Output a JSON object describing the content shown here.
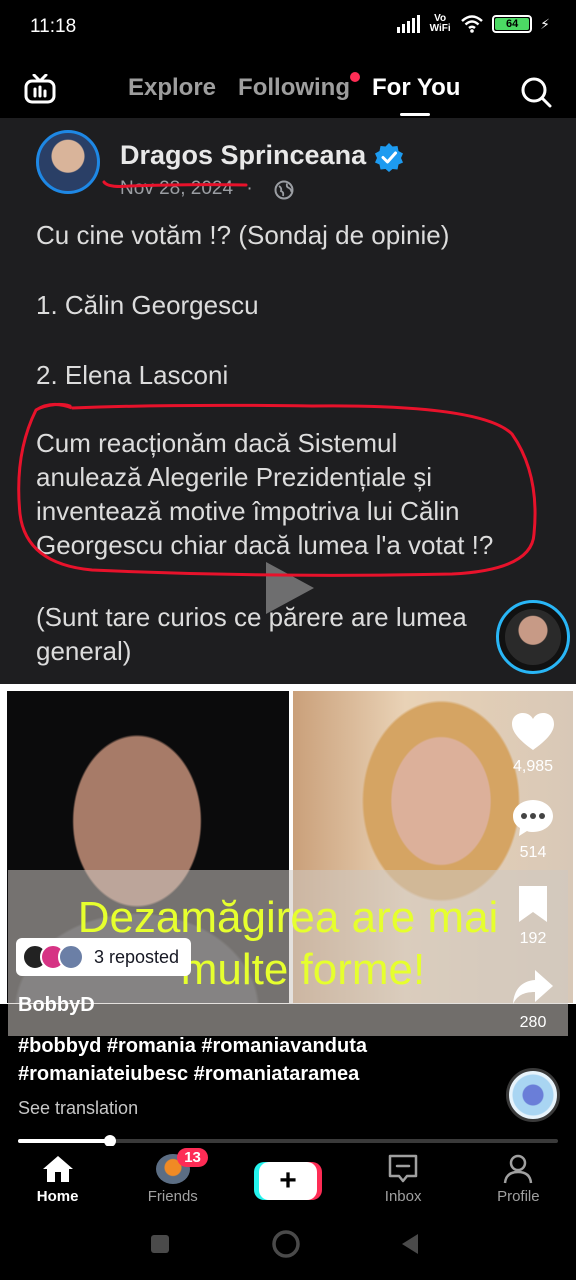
{
  "status_bar": {
    "time": "11:18",
    "network": "Vo WiFi",
    "battery": "64"
  },
  "top_nav": {
    "tabs": [
      {
        "label": "Explore",
        "active": false
      },
      {
        "label": "Following",
        "active": false,
        "has_dot": true
      },
      {
        "label": "For You",
        "active": true
      }
    ]
  },
  "post": {
    "author": "Dragos Sprinceana",
    "date": "Nov 28, 2024",
    "separator": "·",
    "lines": [
      "Cu cine votăm !? (Sondaj de opinie)",
      "1. Călin Georgescu",
      "2. Elena Lasconi",
      "Cum reacționăm dacă Sistemul",
      "anulează Alegerile Prezidențiale și",
      "inventează motive împotriva lui Călin",
      "Georgescu chiar dacă lumea l'a votat !?",
      "(Sunt tare curios ce părere are lumea",
      "general)"
    ]
  },
  "overlay": {
    "line1": "Dezamăgirea are mai",
    "line2": "multe forme!"
  },
  "actions": {
    "likes": "4,985",
    "comments": "514",
    "saves": "192",
    "shares": "280"
  },
  "repost": {
    "label": "3 reposted"
  },
  "video": {
    "username": "BobbyD",
    "caption_line1": "#bobbyd #romania #romaniavanduta",
    "caption_line2": "#romaniateiubesc #romaniataramea",
    "see_translation": "See translation",
    "progress": 0.17
  },
  "bottom_nav": {
    "items": [
      {
        "label": "Home",
        "active": true
      },
      {
        "label": "Friends",
        "badge": "13"
      },
      {
        "label": ""
      },
      {
        "label": "Inbox"
      },
      {
        "label": "Profile"
      }
    ]
  },
  "colors": {
    "accent": "#fe2c55",
    "overlay_text": "#e6ff2e",
    "verified": "#1d9bf0",
    "annotation_red": "#e8122b"
  }
}
